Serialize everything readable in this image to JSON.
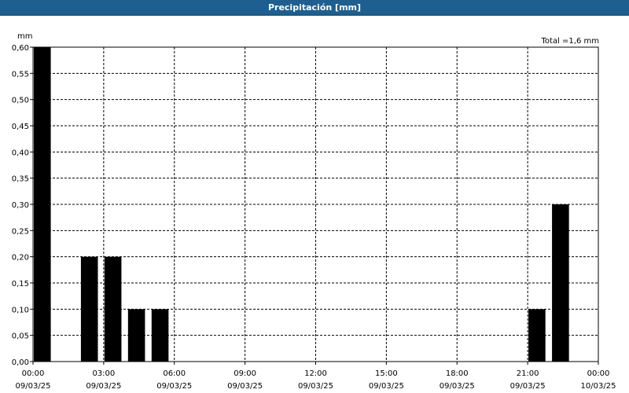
{
  "window": {
    "title": "Precipitación [mm]"
  },
  "chart_data": {
    "type": "bar",
    "title": "Precipitación [mm]",
    "ylabel": "mm",
    "total_label": "Total =1,6 mm",
    "ylim": [
      0,
      0.6
    ],
    "xlim_hours": [
      0,
      24
    ],
    "grid": true,
    "y_ticks": [
      "0,00",
      "0,05",
      "0,10",
      "0,15",
      "0,20",
      "0,25",
      "0,30",
      "0,35",
      "0,40",
      "0,45",
      "0,50",
      "0,55",
      "0,60"
    ],
    "x_ticks": [
      {
        "time": "00:00",
        "date": "09/03/25"
      },
      {
        "time": "03:00",
        "date": "09/03/25"
      },
      {
        "time": "06:00",
        "date": "09/03/25"
      },
      {
        "time": "09:00",
        "date": "09/03/25"
      },
      {
        "time": "12:00",
        "date": "09/03/25"
      },
      {
        "time": "15:00",
        "date": "09/03/25"
      },
      {
        "time": "18:00",
        "date": "09/03/25"
      },
      {
        "time": "21:00",
        "date": "09/03/25"
      },
      {
        "time": "00:00",
        "date": "10/03/25"
      }
    ],
    "bar_color": "#000000",
    "bars": [
      {
        "hour": 0,
        "value": 0.6
      },
      {
        "hour": 2,
        "value": 0.2
      },
      {
        "hour": 3,
        "value": 0.2
      },
      {
        "hour": 4,
        "value": 0.1
      },
      {
        "hour": 5,
        "value": 0.1
      },
      {
        "hour": 21,
        "value": 0.1
      },
      {
        "hour": 22,
        "value": 0.3
      }
    ]
  }
}
